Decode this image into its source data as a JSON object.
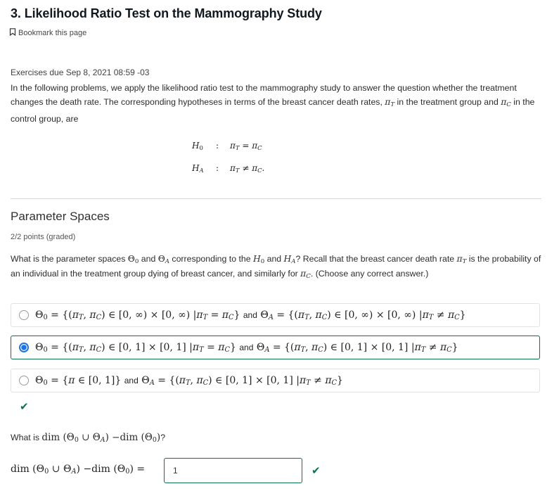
{
  "header": {
    "title": "3. Likelihood Ratio Test on the Mammography Study",
    "bookmark_label": "Bookmark this page"
  },
  "intro": {
    "due": "Exercises due Sep 8, 2021 08:59 -03",
    "text_1": "In the following problems, we apply the likelihood ratio test to the mammography study to answer the question whether the treatment changes the death rate. The corresponding hypotheses in terms of the breast cancer death rates, ",
    "pi_t": "π",
    "pi_t_sub": "T",
    "text_2": " in the treatment group and ",
    "pi_c": "π",
    "pi_c_sub": "C",
    "text_3": " in the control group, are"
  },
  "hypotheses": [
    {
      "lhs": "H",
      "lhs_sub": "0",
      "colon": ":",
      "rhs": "π_T = π_C"
    },
    {
      "lhs": "H",
      "lhs_sub": "A",
      "colon": ":",
      "rhs": "π_T ≠ π_C."
    }
  ],
  "problem": {
    "title": "Parameter Spaces",
    "points": "2/2 points (graded)",
    "question_parts": [
      "What is the parameter spaces ",
      " and ",
      " corresponding to the ",
      " and ",
      "? Recall that the breast cancer death rate ",
      " is the probability of an individual in the treatment group dying of breast cancer, and similarly for ",
      ". (Choose any correct answer.)"
    ],
    "choices": [
      {
        "theta0": "Θ₀ = {(π_T, π_C) ∈ [0, ∞) × [0, ∞) | π_T = π_C}",
        "and": "and",
        "thetaA": "Θ_A = {(π_T, π_C) ∈ [0, ∞) × [0, ∞) | π_T ≠ π_C}",
        "selected": false
      },
      {
        "theta0": "Θ₀ = {(π_T, π_C) ∈ [0, 1] × [0, 1] | π_T = π_C}",
        "and": "and",
        "thetaA": "Θ_A = {(π_T, π_C) ∈ [0, 1] × [0, 1] | π_T ≠ π_C}",
        "selected": true
      },
      {
        "theta0": "Θ₀ = {π ∈ [0, 1]}",
        "and": "and",
        "thetaA": "Θ_A = {(π_T, π_C) ∈ [0, 1] × [0, 1] | π_T ≠ π_C}",
        "selected": false
      }
    ],
    "status_icon": "checkmark-icon",
    "q2_prefix": "What is ",
    "q2_expr": "dim (Θ₀ ∪ Θ_A) −dim (Θ₀)",
    "q2_suffix": "?",
    "answer_label": "dim (Θ₀ ∪ Θ_A) −dim (Θ₀) =",
    "answer_value": "1"
  },
  "colors": {
    "correct": "#0d7349",
    "radio_selected": "#1a73e8",
    "title": "#101820"
  }
}
